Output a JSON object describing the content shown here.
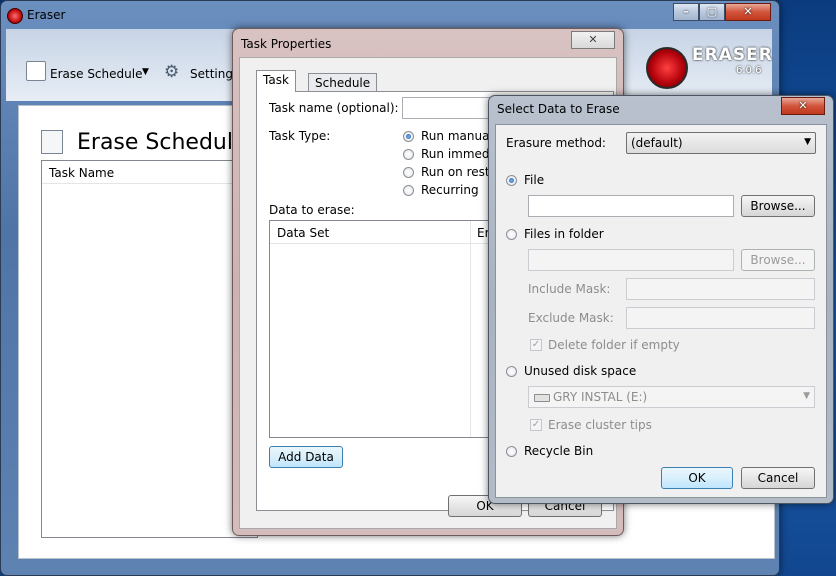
{
  "main_window": {
    "title": "Eraser",
    "toolbar": {
      "erase_schedule": "Erase Schedule",
      "settings": "Settings"
    },
    "logo_text": "ERASER",
    "version": "6.0.6",
    "page_title": "Erase Schedule",
    "column_task_name": "Task Name"
  },
  "task_properties": {
    "title": "Task Properties",
    "tabs": [
      "Task",
      "Schedule"
    ],
    "task_name_label": "Task name (optional):",
    "task_type_label": "Task Type:",
    "task_types": [
      "Run manually",
      "Run immedia",
      "Run on resta",
      "Recurring"
    ],
    "data_to_erase_label": "Data to erase:",
    "columns": [
      "Data Set",
      "Era"
    ],
    "add_data": "Add Data",
    "ok": "OK",
    "cancel": "Cancel"
  },
  "select_data": {
    "title": "Select Data to Erase",
    "erasure_method_label": "Erasure method:",
    "erasure_method_value": "(default)",
    "file_label": "File",
    "browse": "Browse...",
    "files_in_folder_label": "Files in folder",
    "include_mask_label": "Include Mask:",
    "exclude_mask_label": "Exclude Mask:",
    "delete_folder_label": "Delete folder if empty",
    "unused_disk_label": "Unused disk space",
    "drive_value": "GRY INSTAL (E:)",
    "erase_cluster_label": "Erase cluster tips",
    "recycle_bin_label": "Recycle Bin",
    "ok": "OK",
    "cancel": "Cancel"
  },
  "colors": {
    "accent_blue": "#3c7fb1",
    "close_red": "#c0381e",
    "logo_red": "#d0141b"
  }
}
